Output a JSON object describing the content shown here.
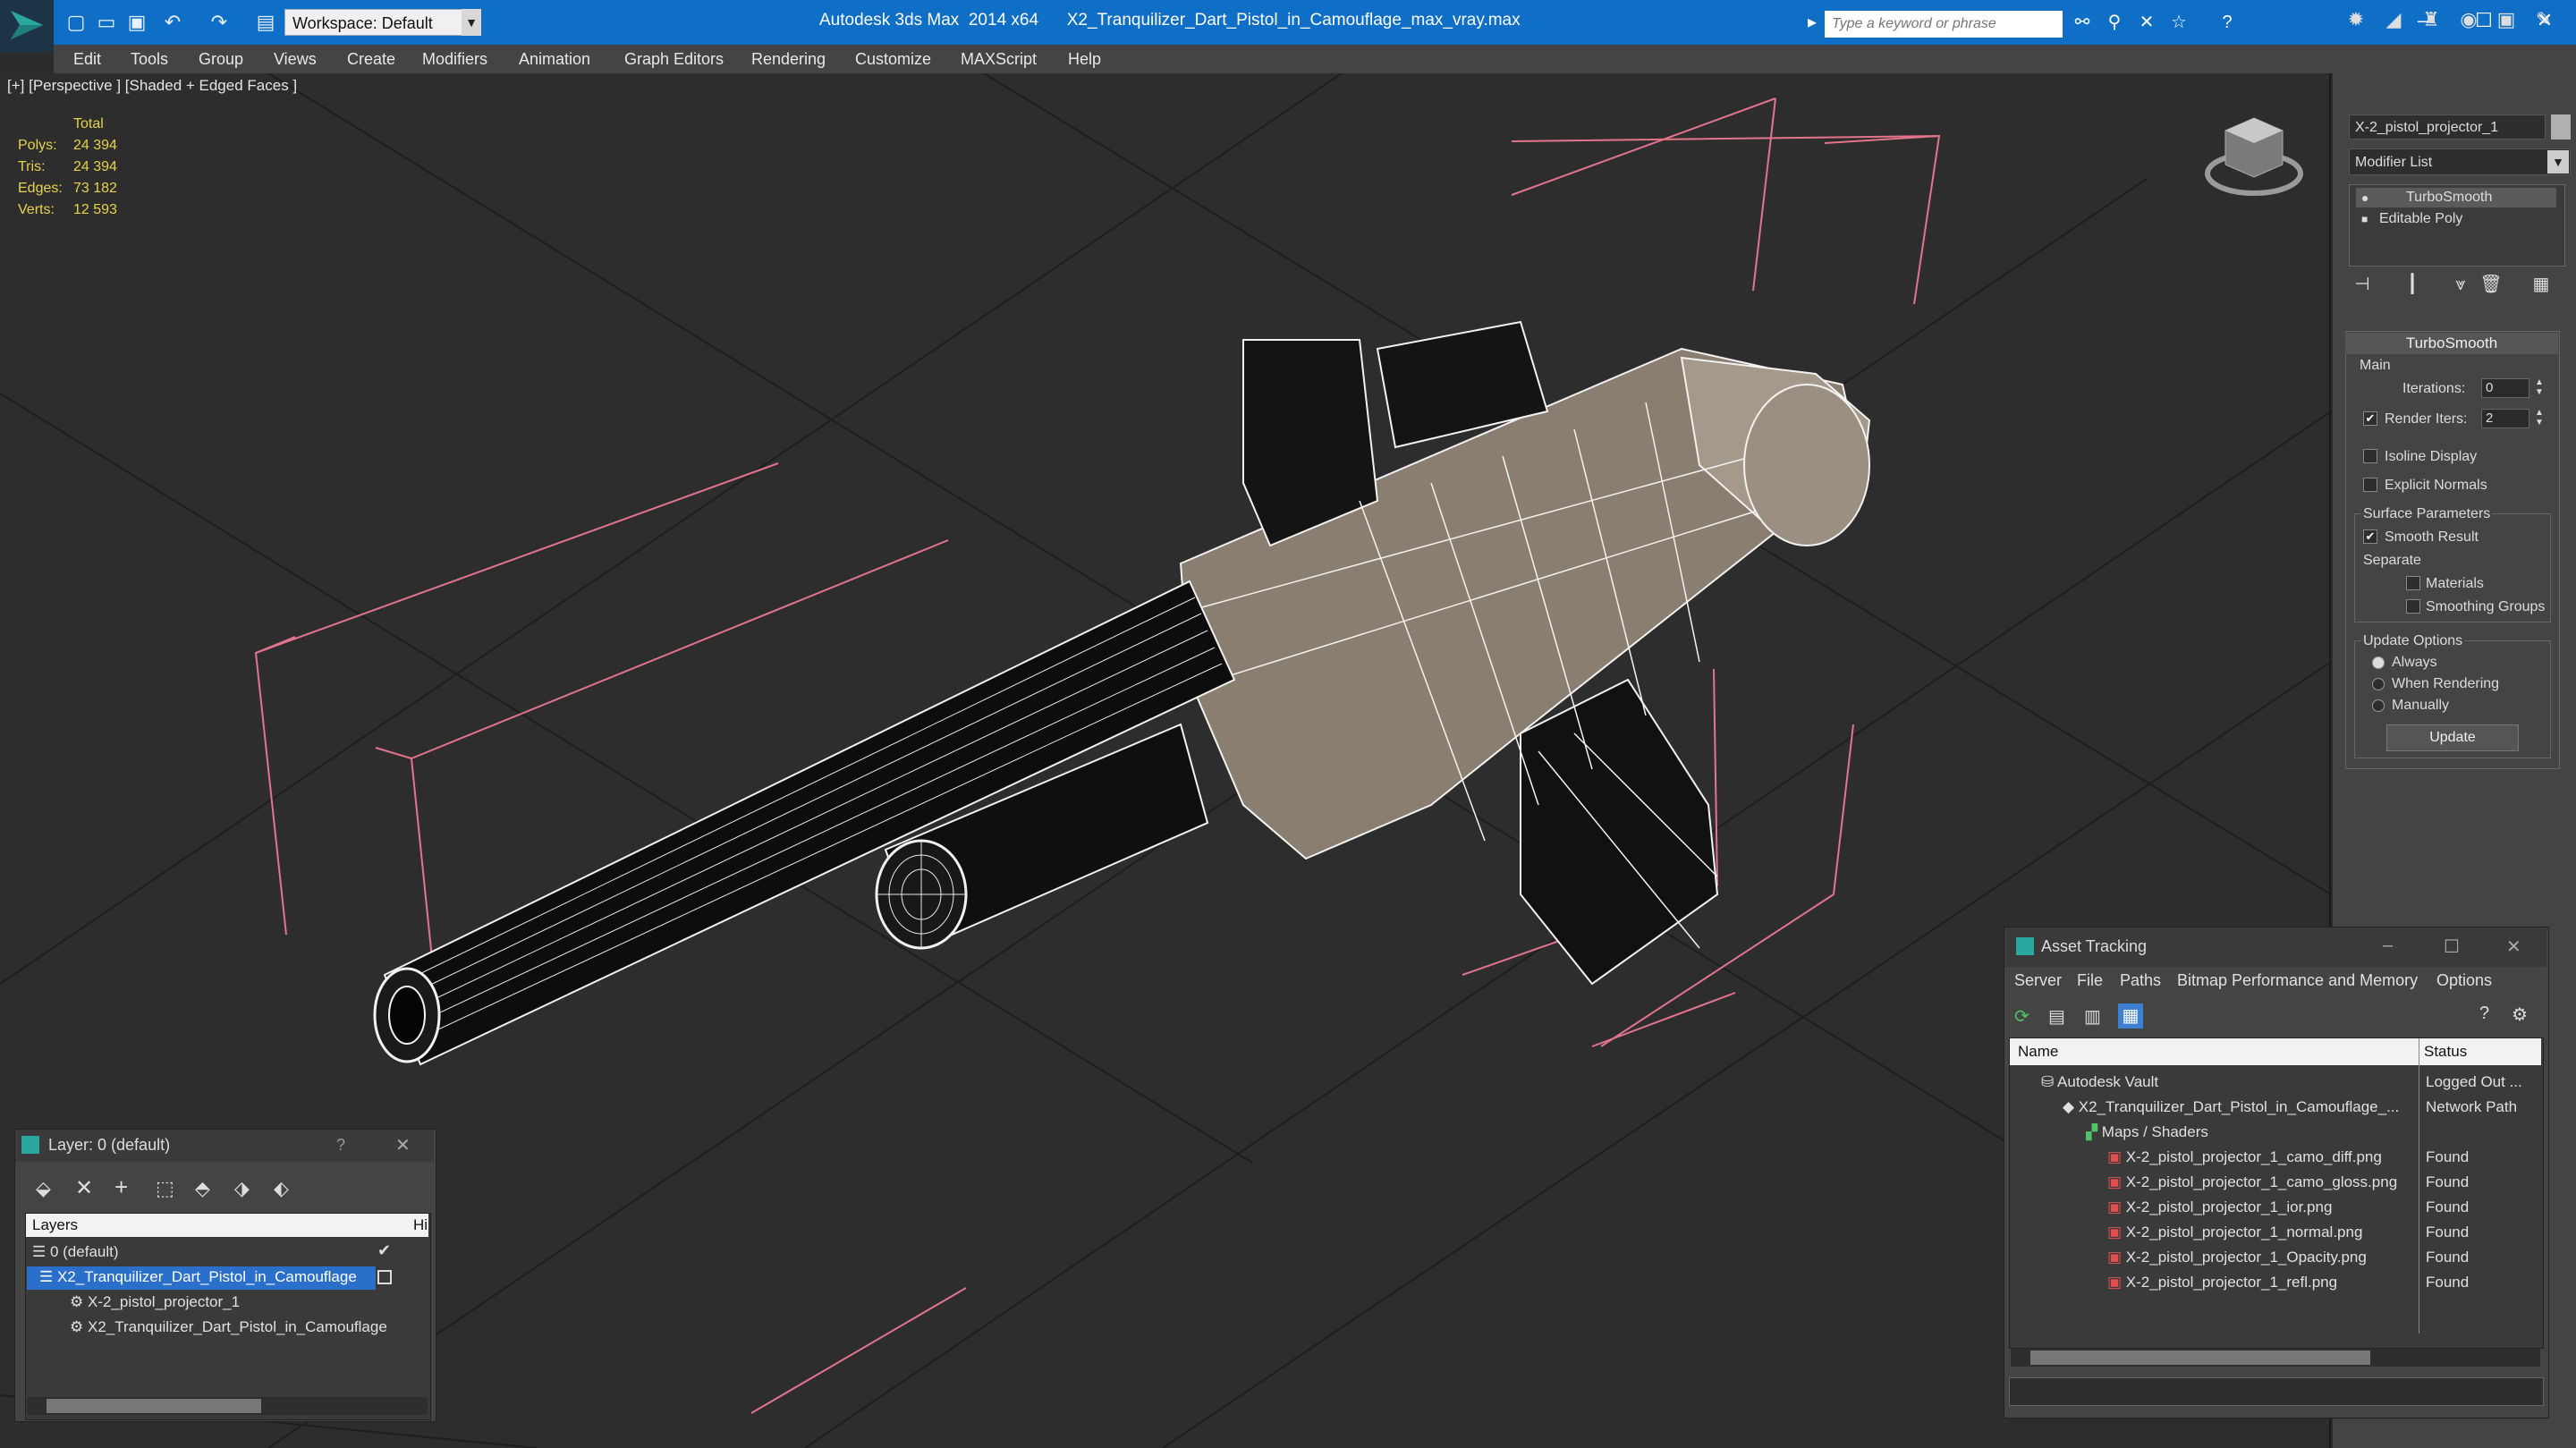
{
  "titlebar": {
    "app_title": "Autodesk 3ds Max  2014 x64      X2_Tranquilizer_Dart_Pistol_in_Camouflage_max_vray.max",
    "workspace": "Workspace: Default",
    "search_placeholder": "Type a keyword or phrase",
    "accent": "#0f6fc6"
  },
  "menu": [
    "Edit",
    "Tools",
    "Group",
    "Views",
    "Create",
    "Modifiers",
    "Animation",
    "Graph Editors",
    "Rendering",
    "Customize",
    "MAXScript",
    "Help"
  ],
  "viewport": {
    "label": "[+] [Perspective ] [Shaded + Edged Faces ]",
    "stats": {
      "header": "Total",
      "rows": [
        {
          "label": "Polys:",
          "value": "24 394"
        },
        {
          "label": "Tris:",
          "value": "24 394"
        },
        {
          "label": "Edges:",
          "value": "73 182"
        },
        {
          "label": "Verts:",
          "value": "12 593"
        }
      ]
    }
  },
  "command_panel": {
    "object_name": "X-2_pistol_projector_1",
    "modifier_list": "Modifier List",
    "stack": [
      "TurboSmooth",
      "Editable Poly"
    ],
    "rollout": {
      "title": "TurboSmooth",
      "main_label": "Main",
      "iterations_label": "Iterations:",
      "iterations_value": "0",
      "render_iters_label": "Render Iters:",
      "render_iters_value": "2",
      "isoline_label": "Isoline Display",
      "explicit_normals_label": "Explicit Normals",
      "surface_params_label": "Surface Parameters",
      "smooth_result_label": "Smooth Result",
      "separate_label": "Separate",
      "materials_label": "Materials",
      "smoothing_groups_label": "Smoothing Groups",
      "update_options_label": "Update Options",
      "always_label": "Always",
      "when_rendering_label": "When Rendering",
      "manually_label": "Manually",
      "update_button": "Update"
    }
  },
  "layer_window": {
    "title": "Layer: 0 (default)",
    "help": "?",
    "header_layers": "Layers",
    "header_hide": "Hi",
    "rows": [
      "0 (default)",
      "X2_Tranquilizer_Dart_Pistol_in_Camouflage",
      "X-2_pistol_projector_1",
      "X2_Tranquilizer_Dart_Pistol_in_Camouflage"
    ]
  },
  "asset_window": {
    "title": "Asset Tracking",
    "menu": [
      "Server",
      "File",
      "Paths",
      "Bitmap Performance and Memory",
      "Options"
    ],
    "col_name": "Name",
    "col_status": "Status",
    "rows": [
      {
        "name": "Autodesk Vault",
        "status": "Logged Out ..."
      },
      {
        "name": "X2_Tranquilizer_Dart_Pistol_in_Camouflage_...",
        "status": "Network Path"
      },
      {
        "name": "Maps / Shaders",
        "status": ""
      },
      {
        "name": "X-2_pistol_projector_1_camo_diff.png",
        "status": "Found"
      },
      {
        "name": "X-2_pistol_projector_1_camo_gloss.png",
        "status": "Found"
      },
      {
        "name": "X-2_pistol_projector_1_ior.png",
        "status": "Found"
      },
      {
        "name": "X-2_pistol_projector_1_normal.png",
        "status": "Found"
      },
      {
        "name": "X-2_pistol_projector_1_Opacity.png",
        "status": "Found"
      },
      {
        "name": "X-2_pistol_projector_1_refl.png",
        "status": "Found"
      }
    ]
  }
}
